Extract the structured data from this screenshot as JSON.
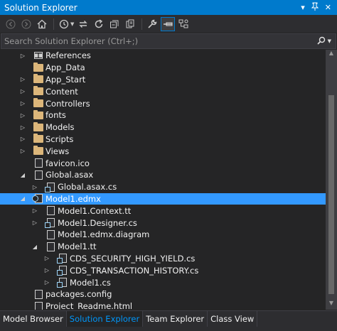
{
  "window": {
    "title": "Solution Explorer",
    "controls": [
      "▾",
      "🖈",
      "✕"
    ]
  },
  "search": {
    "placeholder": "Search Solution Explorer (Ctrl+;)"
  },
  "tree": [
    {
      "label": "References",
      "icon": "references-icon",
      "arrow": "expand-arrow",
      "indent": 0
    },
    {
      "label": "App_Data",
      "icon": "folder-icon",
      "arrow": "",
      "indent": 0
    },
    {
      "label": "App_Start",
      "icon": "folder-icon",
      "arrow": "expand-arrow",
      "indent": 0
    },
    {
      "label": "Content",
      "icon": "folder-icon",
      "arrow": "expand-arrow",
      "indent": 0
    },
    {
      "label": "Controllers",
      "icon": "folder-icon",
      "arrow": "expand-arrow",
      "indent": 0
    },
    {
      "label": "fonts",
      "icon": "folder-icon",
      "arrow": "expand-arrow",
      "indent": 0
    },
    {
      "label": "Models",
      "icon": "folder-icon",
      "arrow": "expand-arrow",
      "indent": 0
    },
    {
      "label": "Scripts",
      "icon": "folder-icon",
      "arrow": "expand-arrow",
      "indent": 0
    },
    {
      "label": "Views",
      "icon": "folder-icon",
      "arrow": "expand-arrow",
      "indent": 0
    },
    {
      "label": "favicon.ico",
      "icon": "file-icon",
      "arrow": "",
      "indent": 0
    },
    {
      "label": "Global.asax",
      "icon": "file-icon",
      "arrow": "collapse-arrow",
      "indent": 0
    },
    {
      "label": "Global.asax.cs",
      "icon": "cs-file-icon",
      "arrow": "expand-arrow",
      "indent": 1
    },
    {
      "label": "Model1.edmx",
      "icon": "edmx-file-icon",
      "arrow": "collapse-arrow",
      "indent": 0,
      "selected": true
    },
    {
      "label": "Model1.Context.tt",
      "icon": "file-icon",
      "arrow": "expand-arrow",
      "indent": 1
    },
    {
      "label": "Model1.Designer.cs",
      "icon": "cs-file-icon",
      "arrow": "expand-arrow",
      "indent": 1
    },
    {
      "label": "Model1.edmx.diagram",
      "icon": "file-icon",
      "arrow": "",
      "indent": 1
    },
    {
      "label": "Model1.tt",
      "icon": "file-icon",
      "arrow": "collapse-arrow",
      "indent": 1
    },
    {
      "label": "CDS_SECURITY_HIGH_YIELD.cs",
      "icon": "cs-file-icon",
      "arrow": "expand-arrow",
      "indent": 2
    },
    {
      "label": "CDS_TRANSACTION_HISTORY.cs",
      "icon": "cs-file-icon",
      "arrow": "expand-arrow",
      "indent": 2
    },
    {
      "label": "Model1.cs",
      "icon": "cs-file-icon",
      "arrow": "expand-arrow",
      "indent": 2
    },
    {
      "label": "packages.config",
      "icon": "file-icon",
      "arrow": "",
      "indent": 0
    },
    {
      "label": "Project_Readme.html",
      "icon": "file-icon",
      "arrow": "",
      "indent": 0
    }
  ],
  "tabs": [
    {
      "label": "Model Browser",
      "active": false
    },
    {
      "label": "Solution Explorer",
      "active": true
    },
    {
      "label": "Team Explorer",
      "active": false
    },
    {
      "label": "Class View",
      "active": false
    }
  ],
  "colors": {
    "accent": "#007acc",
    "selection": "#3399ff",
    "background": "#252526"
  }
}
